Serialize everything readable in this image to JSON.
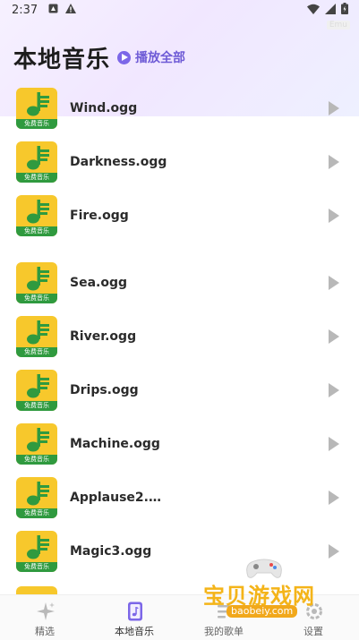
{
  "status": {
    "time": "2:37",
    "tag": "Emu"
  },
  "header": {
    "title": "本地音乐",
    "play_all_label": "播放全部"
  },
  "thumbnail_caption": "免费音乐",
  "songs": [
    {
      "name": "Wind.ogg"
    },
    {
      "name": "Darkness.ogg"
    },
    {
      "name": "Fire.ogg"
    },
    {
      "name": "Sea.ogg"
    },
    {
      "name": "River.ogg"
    },
    {
      "name": "Drips.ogg"
    },
    {
      "name": "Machine.ogg"
    },
    {
      "name": "Applause2.og..."
    },
    {
      "name": "Magic3.ogg"
    }
  ],
  "tabs": [
    {
      "label": "精选"
    },
    {
      "label": "本地音乐"
    },
    {
      "label": "我的歌单"
    },
    {
      "label": "设置"
    }
  ],
  "watermark": {
    "text": "宝贝游戏网",
    "url": "baobeiy.com"
  },
  "colors": {
    "accent": "#7c67e8",
    "thumb_bg": "#f7c82c",
    "thumb_green": "#2f9a3f"
  }
}
